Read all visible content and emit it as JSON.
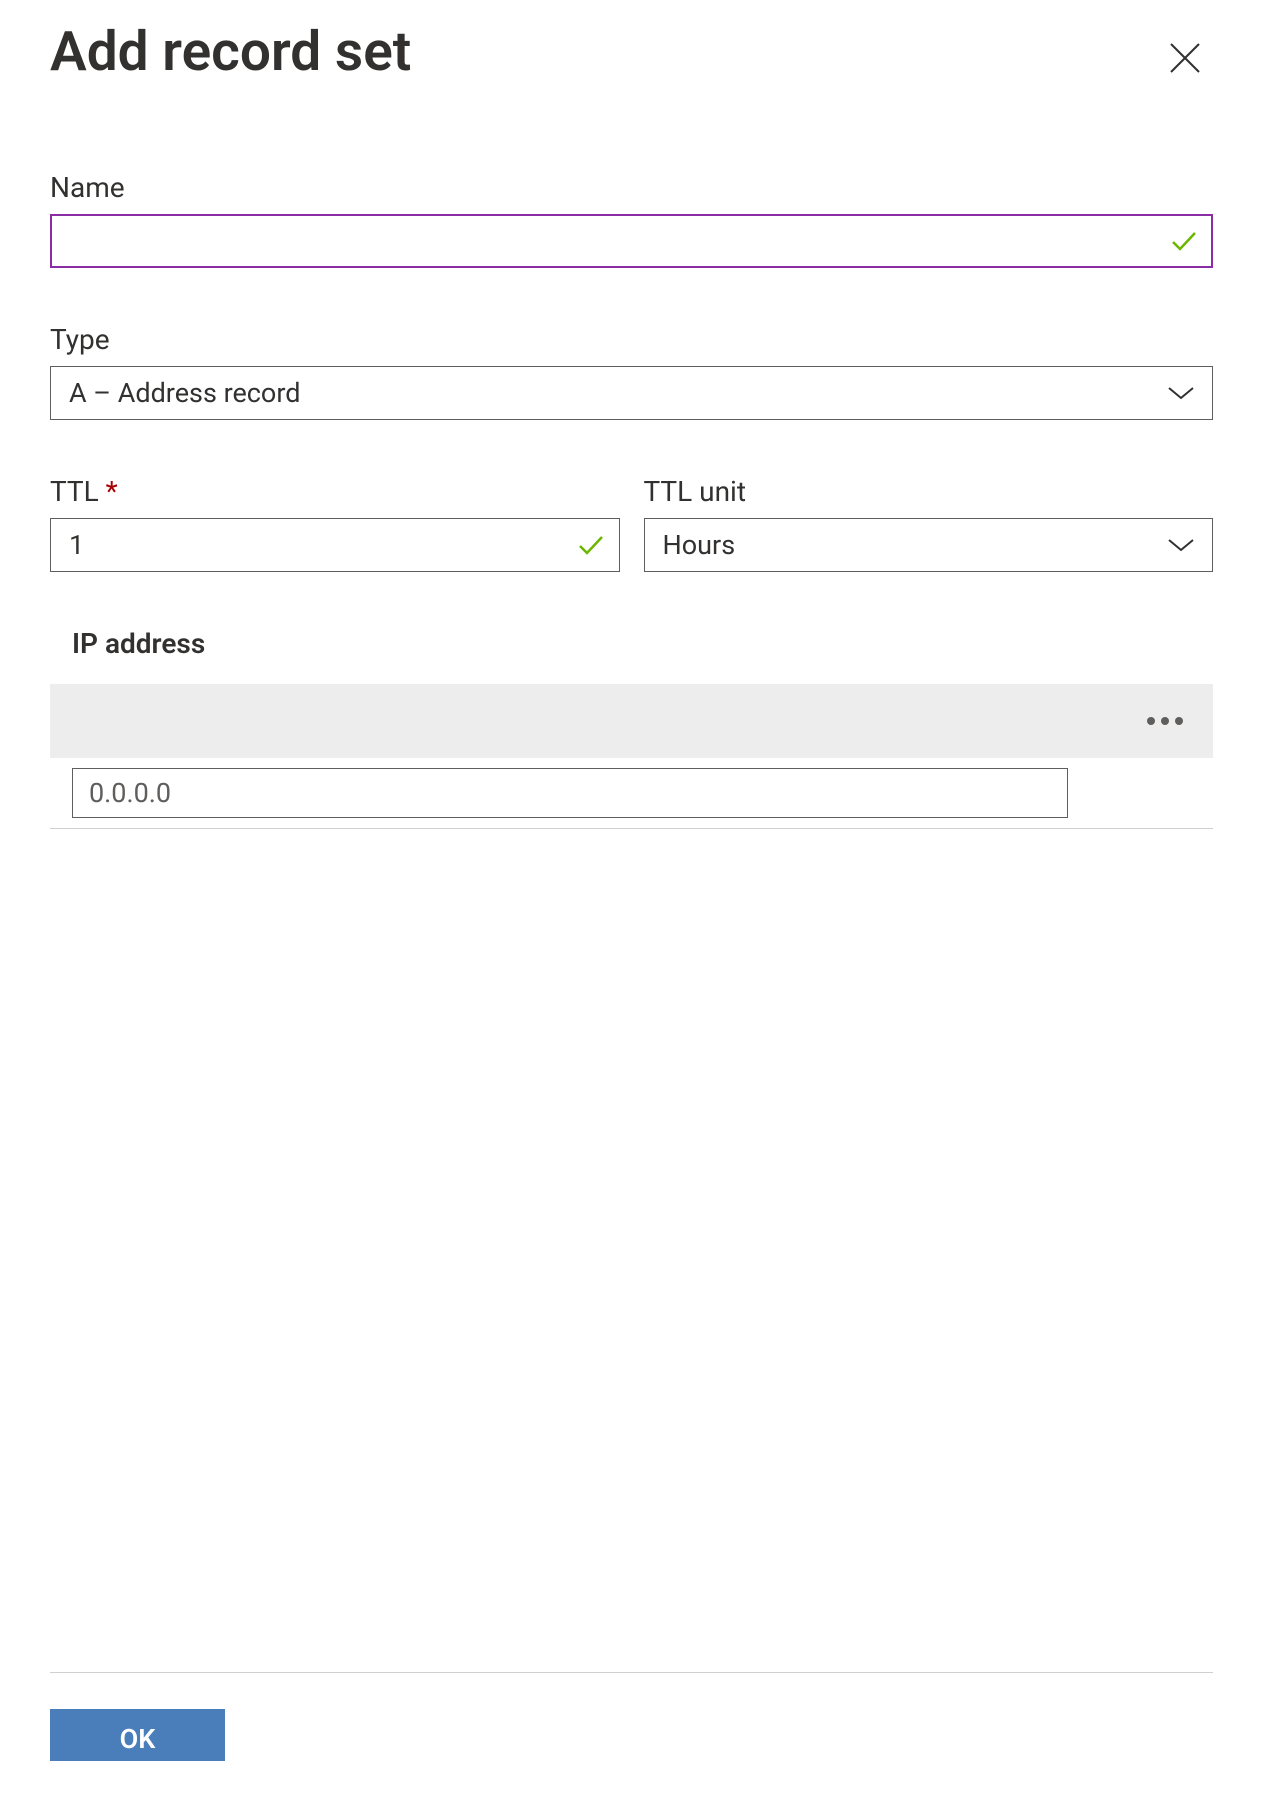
{
  "header": {
    "title": "Add record set"
  },
  "form": {
    "name": {
      "label": "Name",
      "value": ""
    },
    "type": {
      "label": "Type",
      "value": "A – Address record"
    },
    "ttl": {
      "label": "TTL",
      "required": "*",
      "value": "1"
    },
    "ttl_unit": {
      "label": "TTL unit",
      "value": "Hours"
    },
    "ip_address": {
      "label": "IP address",
      "placeholder": "0.0.0.0",
      "value": ""
    }
  },
  "footer": {
    "ok_label": "OK"
  }
}
